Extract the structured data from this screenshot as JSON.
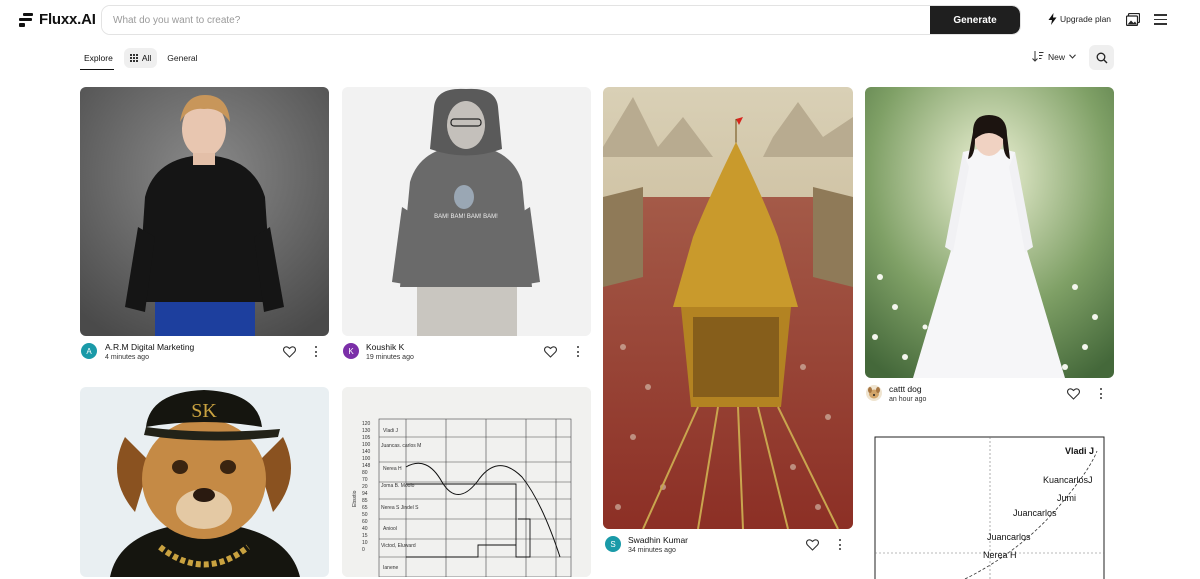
{
  "app": {
    "name": "Fluxx.AI"
  },
  "search": {
    "placeholder": "What do you want to create?",
    "button_label": "Generate"
  },
  "header": {
    "upgrade_label": "Upgrade plan"
  },
  "tabs": {
    "explore": "Explore",
    "all": "All",
    "general": "General"
  },
  "sort": {
    "label": "New"
  },
  "cards": [
    {
      "author": "A.R.M Digital Marketing",
      "avatar_letter": "A",
      "avatar_color": "#1a9aa8",
      "time": "4 minutes ago"
    },
    {
      "author": "Koushik K",
      "avatar_letter": "K",
      "avatar_color": "#7b2fa8",
      "time": "19 minutes ago"
    },
    {
      "author": "Swadhin Kumar",
      "avatar_letter": "S",
      "avatar_color": "#1a9aa8",
      "time": "34 minutes ago"
    },
    {
      "author": "cattt dog",
      "time": "an hour ago"
    }
  ],
  "hoodie_text": "BAM! BAM! BAM! BAM!",
  "chart_image": {
    "axis_label": "Ebsxtio",
    "y_ticks": [
      "120",
      "130",
      "105",
      "100",
      "140",
      "100",
      "148",
      "80",
      "70",
      "20",
      "94",
      "85",
      "65",
      "50",
      "60",
      "40",
      "15",
      "10",
      "0"
    ],
    "row_labels": [
      "Vladi J",
      "Juancas. carlos M",
      "Nerea H",
      "Joma B. Moolo",
      "Nerea S Jindel S",
      "Aniool",
      "Victod, Eluward",
      "Ianene"
    ]
  },
  "chart_image_2": {
    "labels": [
      "Vladi J",
      "KuancarlosJ",
      "Jumi",
      "Juancarlos",
      "Juancarlos",
      "Nerea H"
    ]
  }
}
